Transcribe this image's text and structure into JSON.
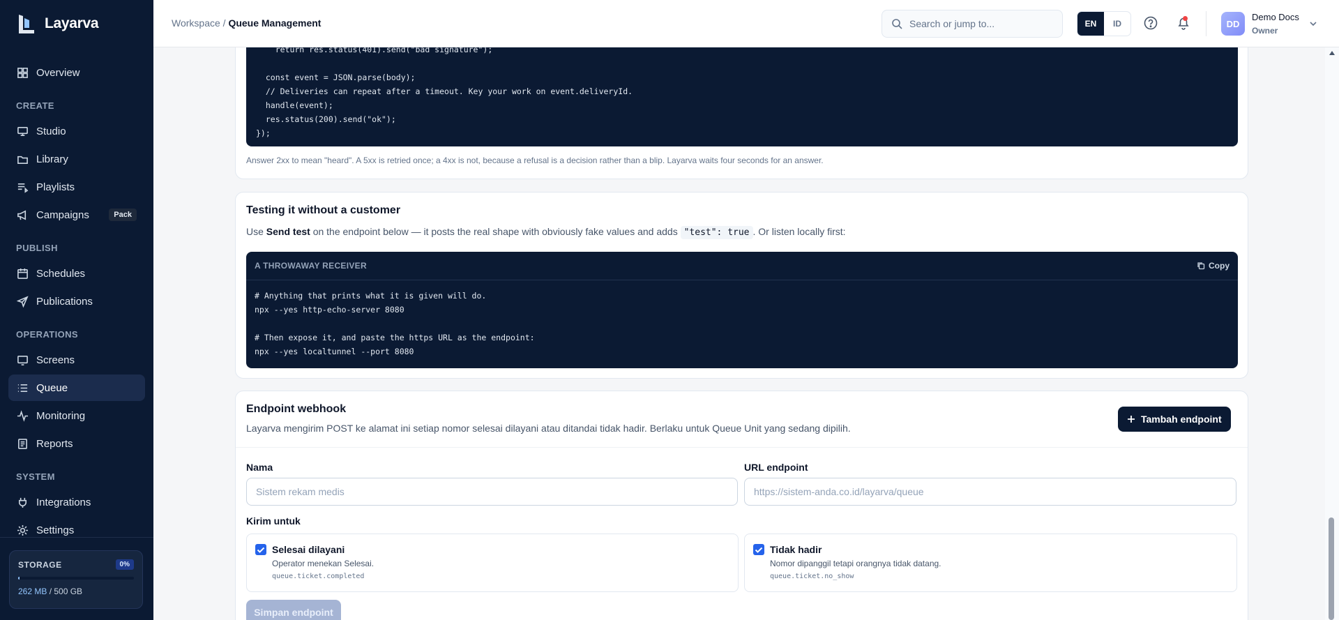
{
  "app": {
    "name": "Layarva"
  },
  "sidebar": {
    "items_top": [
      {
        "label": "Overview",
        "icon": "grid-icon"
      }
    ],
    "sections": [
      {
        "title": "CREATE",
        "items": [
          {
            "label": "Studio",
            "icon": "monitor-icon"
          },
          {
            "label": "Library",
            "icon": "folder-icon"
          },
          {
            "label": "Playlists",
            "icon": "list-icon"
          },
          {
            "label": "Campaigns",
            "icon": "megaphone-icon",
            "badge": "Pack"
          }
        ]
      },
      {
        "title": "PUBLISH",
        "items": [
          {
            "label": "Schedules",
            "icon": "calendar-icon"
          },
          {
            "label": "Publications",
            "icon": "send-icon"
          }
        ]
      },
      {
        "title": "OPERATIONS",
        "items": [
          {
            "label": "Screens",
            "icon": "screen-icon"
          },
          {
            "label": "Queue",
            "icon": "queue-icon",
            "active": true
          },
          {
            "label": "Monitoring",
            "icon": "activity-icon"
          },
          {
            "label": "Reports",
            "icon": "report-icon"
          }
        ]
      },
      {
        "title": "SYSTEM",
        "items": [
          {
            "label": "Integrations",
            "icon": "plug-icon"
          },
          {
            "label": "Settings",
            "icon": "gear-icon"
          }
        ]
      }
    ],
    "storage": {
      "label": "STORAGE",
      "percent_label": "0%",
      "percent": 0.005,
      "used": "262 MB",
      "total": "/ 500 GB"
    }
  },
  "topbar": {
    "breadcrumb_root": "Workspace /",
    "breadcrumb_current": "Queue Management",
    "search_placeholder": "Search or jump to...",
    "lang": [
      "EN",
      "ID"
    ],
    "user_initials": "DD",
    "user_name": "Demo Docs",
    "user_role": "Owner"
  },
  "code_block_1": {
    "lines": [
      "    return res.status(401).send(\"bad signature\");",
      "",
      "  const event = JSON.parse(body);",
      "  // Deliveries can repeat after a timeout. Key your work on event.deliveryId.",
      "  handle(event);",
      "  res.status(200).send(\"ok\");",
      "});"
    ],
    "note": "Answer 2xx to mean \"heard\". A 5xx is retried once; a 4xx is not, because a refusal is a decision rather than a blip. Layarva waits four seconds for an answer."
  },
  "testing": {
    "title": "Testing it without a customer",
    "text_pre": "Use ",
    "text_bold": "Send test",
    "text_mid": " on the endpoint below — it posts the real shape with obviously fake values and adds ",
    "text_code": "\"test\": true",
    "text_post": ". Or listen locally first:",
    "code_label": "A THROWAWAY RECEIVER",
    "copy_label": "Copy",
    "lines": [
      "# Anything that prints what it is given will do.",
      "npx --yes http-echo-server 8080",
      "",
      "# Then expose it, and paste the https URL as the endpoint:",
      "npx --yes localtunnel --port 8080"
    ]
  },
  "webhook": {
    "title": "Endpoint webhook",
    "desc": "Layarva mengirim POST ke alamat ini setiap nomor selesai dilayani atau ditandai tidak hadir. Berlaku untuk Queue Unit yang sedang dipilih.",
    "add_button": "Tambah endpoint",
    "name_label": "Nama",
    "name_placeholder": "Sistem rekam medis",
    "url_label": "URL endpoint",
    "url_placeholder": "https://sistem-anda.co.id/layarva/queue",
    "send_for": "Kirim untuk",
    "options": [
      {
        "title": "Selesai dilayani",
        "desc": "Operator menekan Selesai.",
        "code": "queue.ticket.completed",
        "checked": true
      },
      {
        "title": "Tidak hadir",
        "desc": "Nomor dipanggil tetapi orangnya tidak datang.",
        "code": "queue.ticket.no_show",
        "checked": true
      }
    ],
    "save_button": "Simpan endpoint"
  }
}
